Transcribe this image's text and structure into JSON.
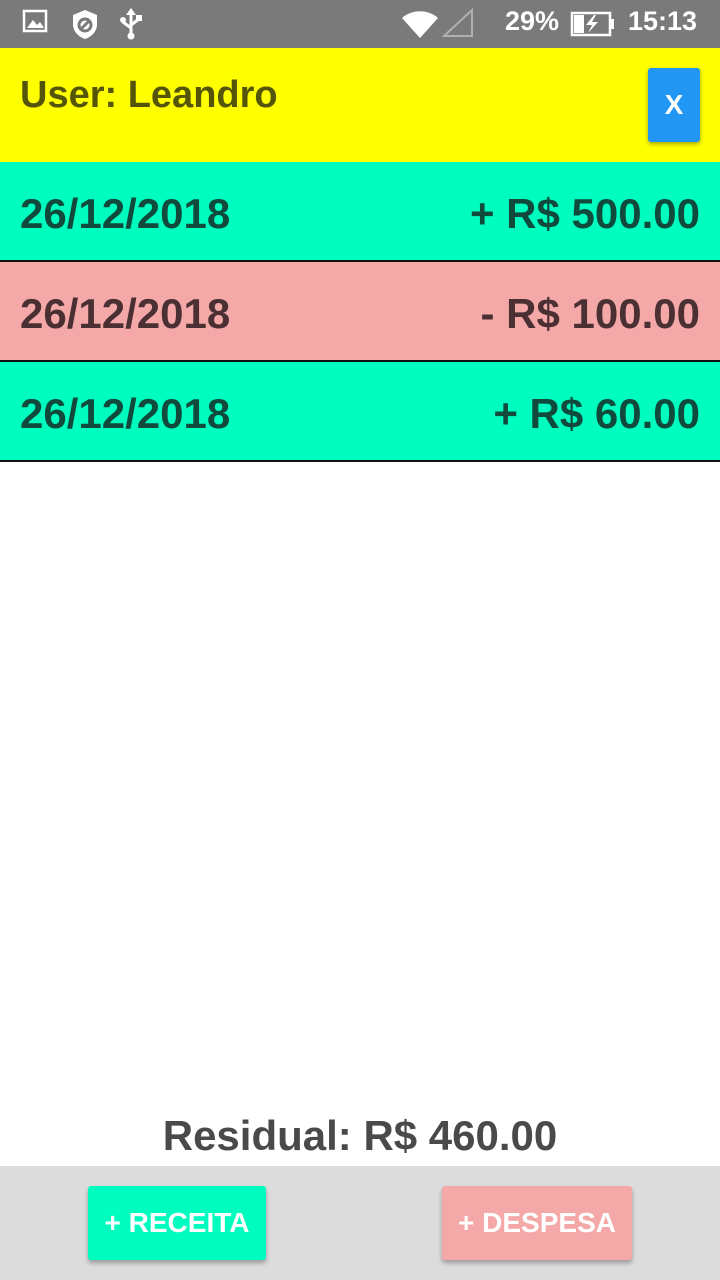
{
  "status_bar": {
    "battery": "29%",
    "time": "15:13",
    "icons": [
      "image-icon",
      "block-icon",
      "usb-icon",
      "wifi-icon",
      "signal-icon",
      "battery-charging-icon"
    ]
  },
  "header": {
    "user_label": "User: Leandro",
    "close_label": "X"
  },
  "transactions": [
    {
      "date": "26/12/2018",
      "amount": "+ R$ 500.00",
      "type": "income"
    },
    {
      "date": "26/12/2018",
      "amount": "- R$ 100.00",
      "type": "expense"
    },
    {
      "date": "26/12/2018",
      "amount": "+ R$ 60.00",
      "type": "income"
    }
  ],
  "residual": "Residual: R$ 460.00",
  "buttons": {
    "receita": "+ RECEITA",
    "despesa": "+ DESPESA"
  },
  "colors": {
    "header": "#ffff00",
    "income": "#00fdc0",
    "expense": "#f4a8a8",
    "close_button": "#2196f3"
  }
}
